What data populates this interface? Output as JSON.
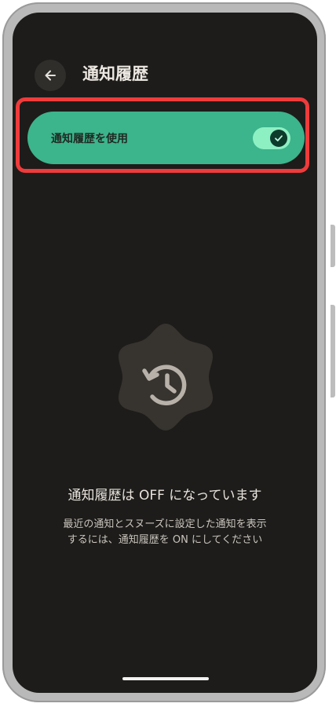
{
  "header": {
    "title": "通知履歴",
    "back_icon": "arrow-left-icon"
  },
  "setting": {
    "label": "通知履歴を使用",
    "switch_state": "on",
    "switch_icon": "checkmark-icon",
    "highlight_color": "#ef3b3b",
    "card_color": "#3cb48c"
  },
  "empty_state": {
    "icon": "history-icon",
    "title": "通知履歴は OFF になっています",
    "description_line1": "最近の通知とスヌーズに設定した通知を表示",
    "description_line2": "するには、通知履歴を ON にしてください"
  }
}
